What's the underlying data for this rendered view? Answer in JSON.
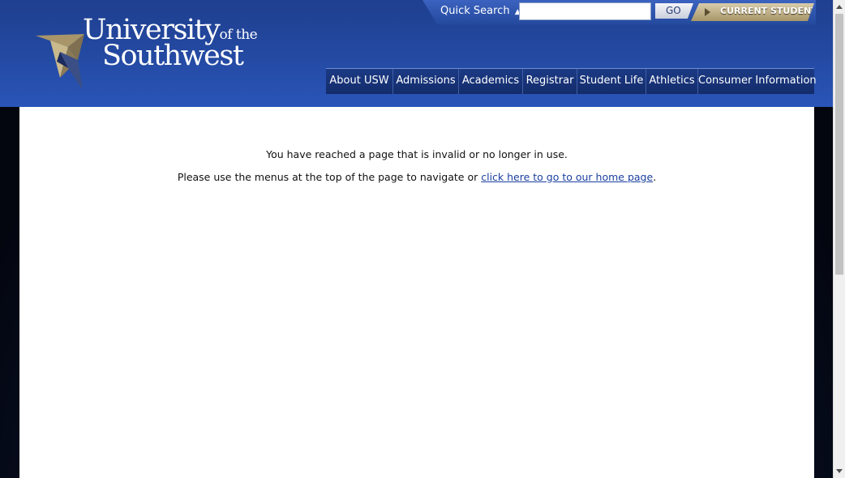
{
  "logo": {
    "line1_main": "University",
    "line1_small": "of the",
    "line2": "Southwest",
    "mark_icon": "compass-star-icon",
    "colors": {
      "gold": "#a8966a",
      "white": "#ffffff"
    }
  },
  "quick_search": {
    "label": "Quick Search",
    "arrow": "▲",
    "input_value": "",
    "go_label": "GO"
  },
  "current_student": {
    "label": "CURRENT STUDENT",
    "icon": "play-arrow-icon"
  },
  "nav": {
    "items": [
      {
        "label": "About USW"
      },
      {
        "label": "Admissions"
      },
      {
        "label": "Academics"
      },
      {
        "label": "Registrar"
      },
      {
        "label": "Student Life"
      },
      {
        "label": "Athletics"
      },
      {
        "label": "Consumer Information"
      }
    ]
  },
  "content": {
    "message1": "You have reached a page that is invalid or no longer in use.",
    "message2_prefix": "Please use the menus at the top of the page to navigate or ",
    "home_link": "click here to go to our home page",
    "message2_suffix": "."
  },
  "colors": {
    "header_blue": "#244aa3",
    "nav_blue": "#1b3a85",
    "link_blue": "#1a3fa0",
    "accent_gold": "#a89668"
  }
}
